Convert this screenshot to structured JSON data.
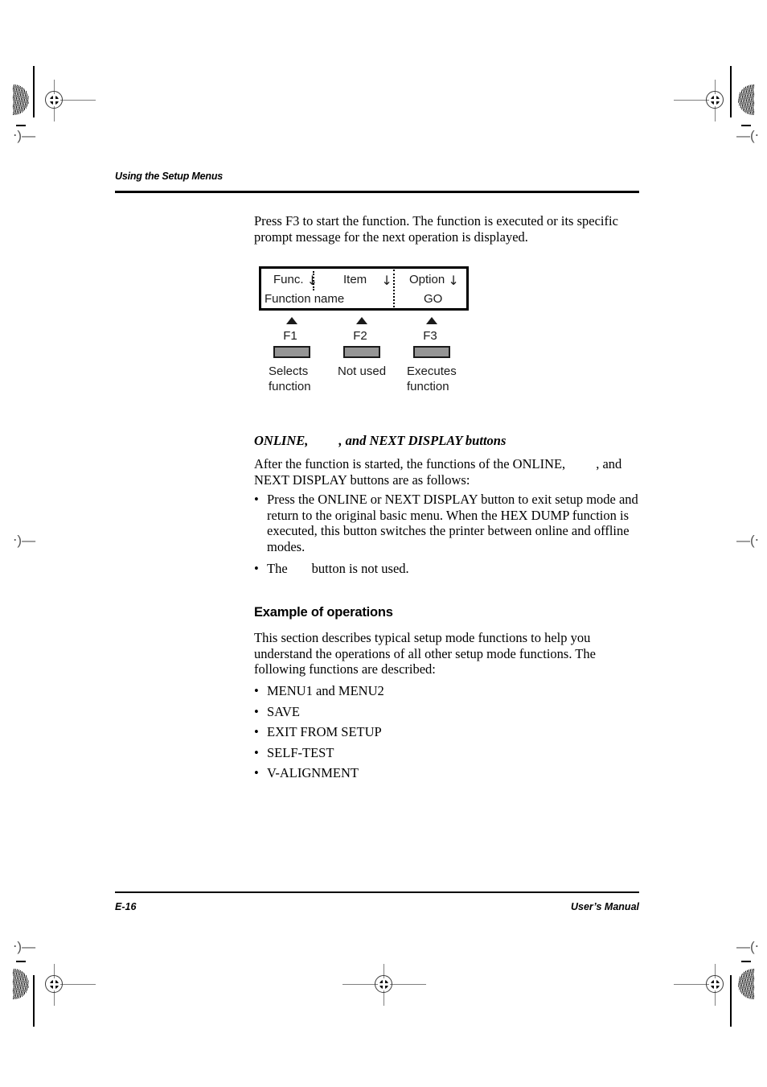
{
  "page": {
    "running_head": "Using the Setup Menus",
    "folio": "E-16",
    "manual_label": "User’s Manual"
  },
  "intro": {
    "paragraph": "Press F3 to start the function. The function is executed or its specific prompt message for the next operation is displayed."
  },
  "lcd_diagram": {
    "cells": {
      "func_label": "Func.",
      "func_value": "Function name",
      "item_label": "Item",
      "item_value": "",
      "option_label": "Option",
      "option_value": "GO"
    },
    "arrow_glyph": "↓",
    "keys": [
      {
        "name": "F1",
        "caption_line1": "Selects",
        "caption_line2": "function"
      },
      {
        "name": "F2",
        "caption_line1": "Not used",
        "caption_line2": ""
      },
      {
        "name": "F3",
        "caption_line1": "Executes",
        "caption_line2": "function"
      }
    ],
    "button_fill": "#959595",
    "button_border": "#1a1a1a"
  },
  "online_section": {
    "heading_part1": "ONLINE,",
    "heading_part2": ", and NEXT DISPLAY buttons",
    "intro_part1": "After the function is started, the functions of the ONLINE,",
    "intro_part2": ", and",
    "intro_line2": "NEXT DISPLAY buttons are as follows:",
    "bullets": [
      "Press the ONLINE or NEXT DISPLAY button to exit setup mode and return to the original basic menu. When the HEX DUMP function is executed, this button switches the printer between online and offline modes."
    ],
    "bullet2_part1": "The",
    "bullet2_part2": "button is not used."
  },
  "example_section": {
    "heading": "Example of operations",
    "paragraph": "This section describes typical setup mode functions to help you understand the operations of all other setup mode functions. The following functions are described:",
    "items": [
      "MENU1 and MENU2",
      "SAVE",
      "EXIT FROM SETUP",
      "SELF-TEST",
      "V-ALIGNMENT"
    ]
  }
}
